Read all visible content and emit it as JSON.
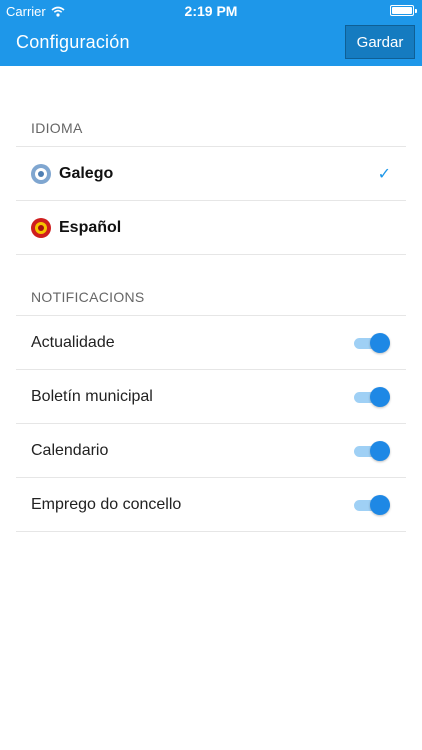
{
  "status_bar": {
    "carrier": "Carrier",
    "time": "2:19 PM"
  },
  "nav": {
    "title": "Configuración",
    "save_label": "Gardar"
  },
  "language_section": {
    "header": "IDIOMA",
    "items": [
      {
        "label": "Galego",
        "selected": true
      },
      {
        "label": "Español",
        "selected": false
      }
    ],
    "check": "✓"
  },
  "notifications_section": {
    "header": "NOTIFICACIONS",
    "items": [
      {
        "label": "Actualidade",
        "enabled": true
      },
      {
        "label": "Boletín municipal",
        "enabled": true
      },
      {
        "label": "Calendario",
        "enabled": true
      },
      {
        "label": "Emprego do concello",
        "enabled": true
      }
    ]
  },
  "colors": {
    "accent": "#1e97e9",
    "toggle_on": "#1e88e5"
  }
}
